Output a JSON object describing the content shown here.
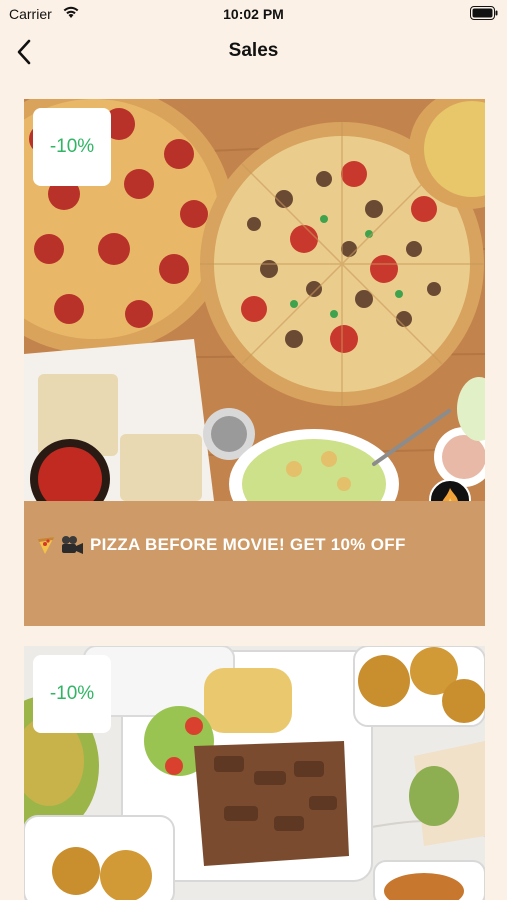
{
  "status_bar": {
    "carrier": "Carrier",
    "time": "10:02 PM"
  },
  "nav": {
    "title": "Sales"
  },
  "sales": [
    {
      "discount": "-10%",
      "caption": "PIZZA BEFORE MOVIE! GET 10% OFF",
      "emoji": [
        "pizza-icon",
        "movie-camera-icon"
      ]
    },
    {
      "discount": "-10%"
    }
  ],
  "colors": {
    "background": "#FCF1E6",
    "card_footer": "#CE9B68",
    "discount_text": "#31B565"
  }
}
